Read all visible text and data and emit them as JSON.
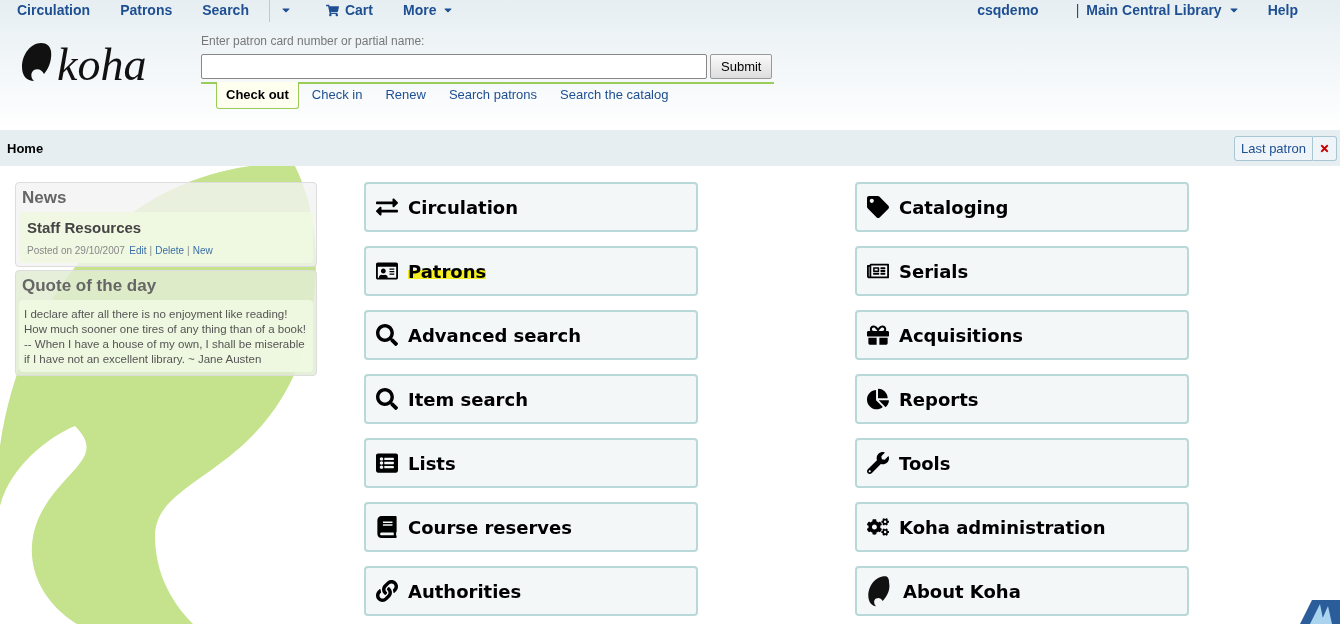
{
  "logo": "koha",
  "top_nav": {
    "left": [
      {
        "label": "Circulation",
        "kind": "link"
      },
      {
        "label": "Patrons",
        "kind": "link"
      },
      {
        "label": "Search",
        "kind": "split"
      },
      {
        "label": "Cart",
        "kind": "cart"
      },
      {
        "label": "More",
        "kind": "menu"
      }
    ],
    "user": "csqdemo",
    "separator": "|",
    "library": "Main Central Library",
    "help": "Help"
  },
  "search": {
    "label": "Enter patron card number or partial name:",
    "button": "Submit",
    "tabs": [
      {
        "label": "Check out",
        "selected": true
      },
      {
        "label": "Check in",
        "selected": false
      },
      {
        "label": "Renew",
        "selected": false
      },
      {
        "label": "Search patrons",
        "selected": false
      },
      {
        "label": "Search the catalog",
        "selected": false
      }
    ]
  },
  "breadcrumb": "Home",
  "last_patron": "Last patron",
  "news": {
    "title": "News",
    "items": [
      {
        "title": "Staff Resources",
        "posted": "Posted on 29/10/2007",
        "actions": [
          "Edit",
          "Delete",
          "New"
        ],
        "separator": "|"
      }
    ]
  },
  "quote": {
    "title": "Quote of the day",
    "text": "I declare after all there is no enjoyment like reading! How much sooner one tires of any thing than of a book! -- When I have a house of my own, I shall be miserable if I have not an excellent library. ~ Jane Austen"
  },
  "modules": {
    "left": [
      {
        "label": "Circulation",
        "highlighted": false
      },
      {
        "label": "Patrons",
        "highlighted": true
      },
      {
        "label": "Advanced search",
        "highlighted": false
      },
      {
        "label": "Item search",
        "highlighted": false
      },
      {
        "label": "Lists",
        "highlighted": false
      },
      {
        "label": "Course reserves",
        "highlighted": false
      },
      {
        "label": "Authorities",
        "highlighted": false
      }
    ],
    "right": [
      {
        "label": "Cataloging",
        "highlighted": false
      },
      {
        "label": "Serials",
        "highlighted": false
      },
      {
        "label": "Acquisitions",
        "highlighted": false
      },
      {
        "label": "Reports",
        "highlighted": false
      },
      {
        "label": "Tools",
        "highlighted": false
      },
      {
        "label": "Koha administration",
        "highlighted": false
      },
      {
        "label": "About Koha",
        "highlighted": false
      }
    ]
  }
}
